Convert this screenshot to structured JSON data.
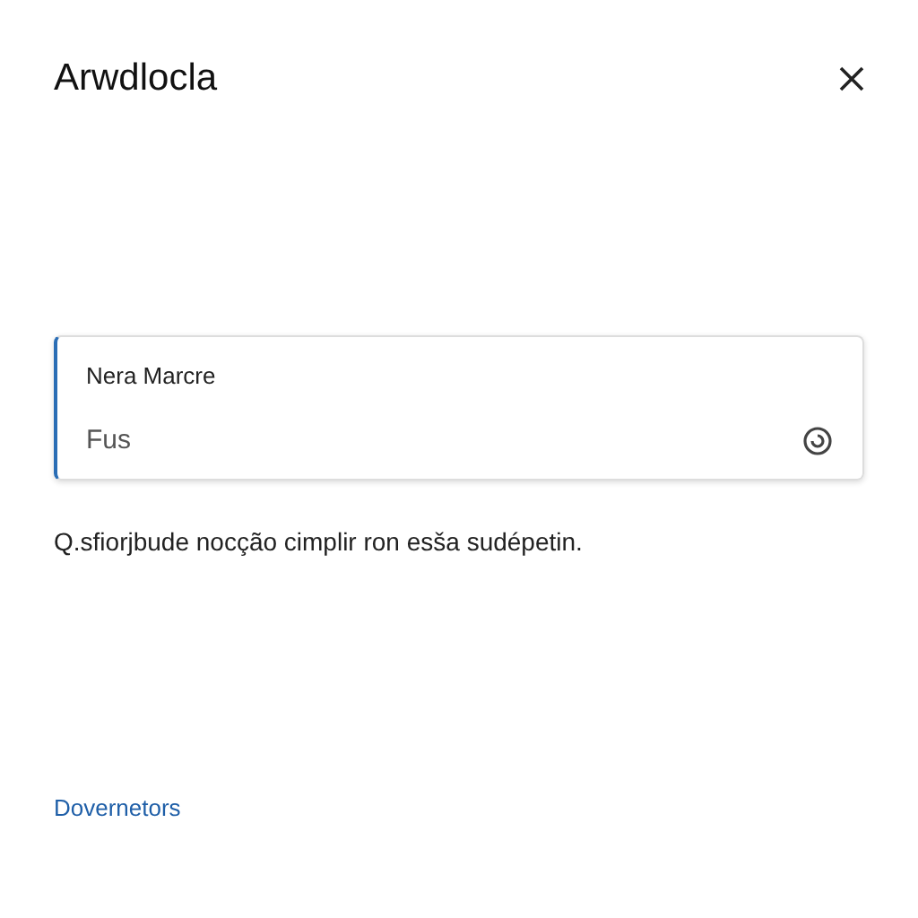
{
  "dialog": {
    "title": "Arwdlocla"
  },
  "field": {
    "label": "Nera Marcre",
    "value": "Fus",
    "focused": true
  },
  "message": "Q.sfiorjbude nocção cimplir ron esša sudépetin.",
  "link": "Dovernetors"
}
